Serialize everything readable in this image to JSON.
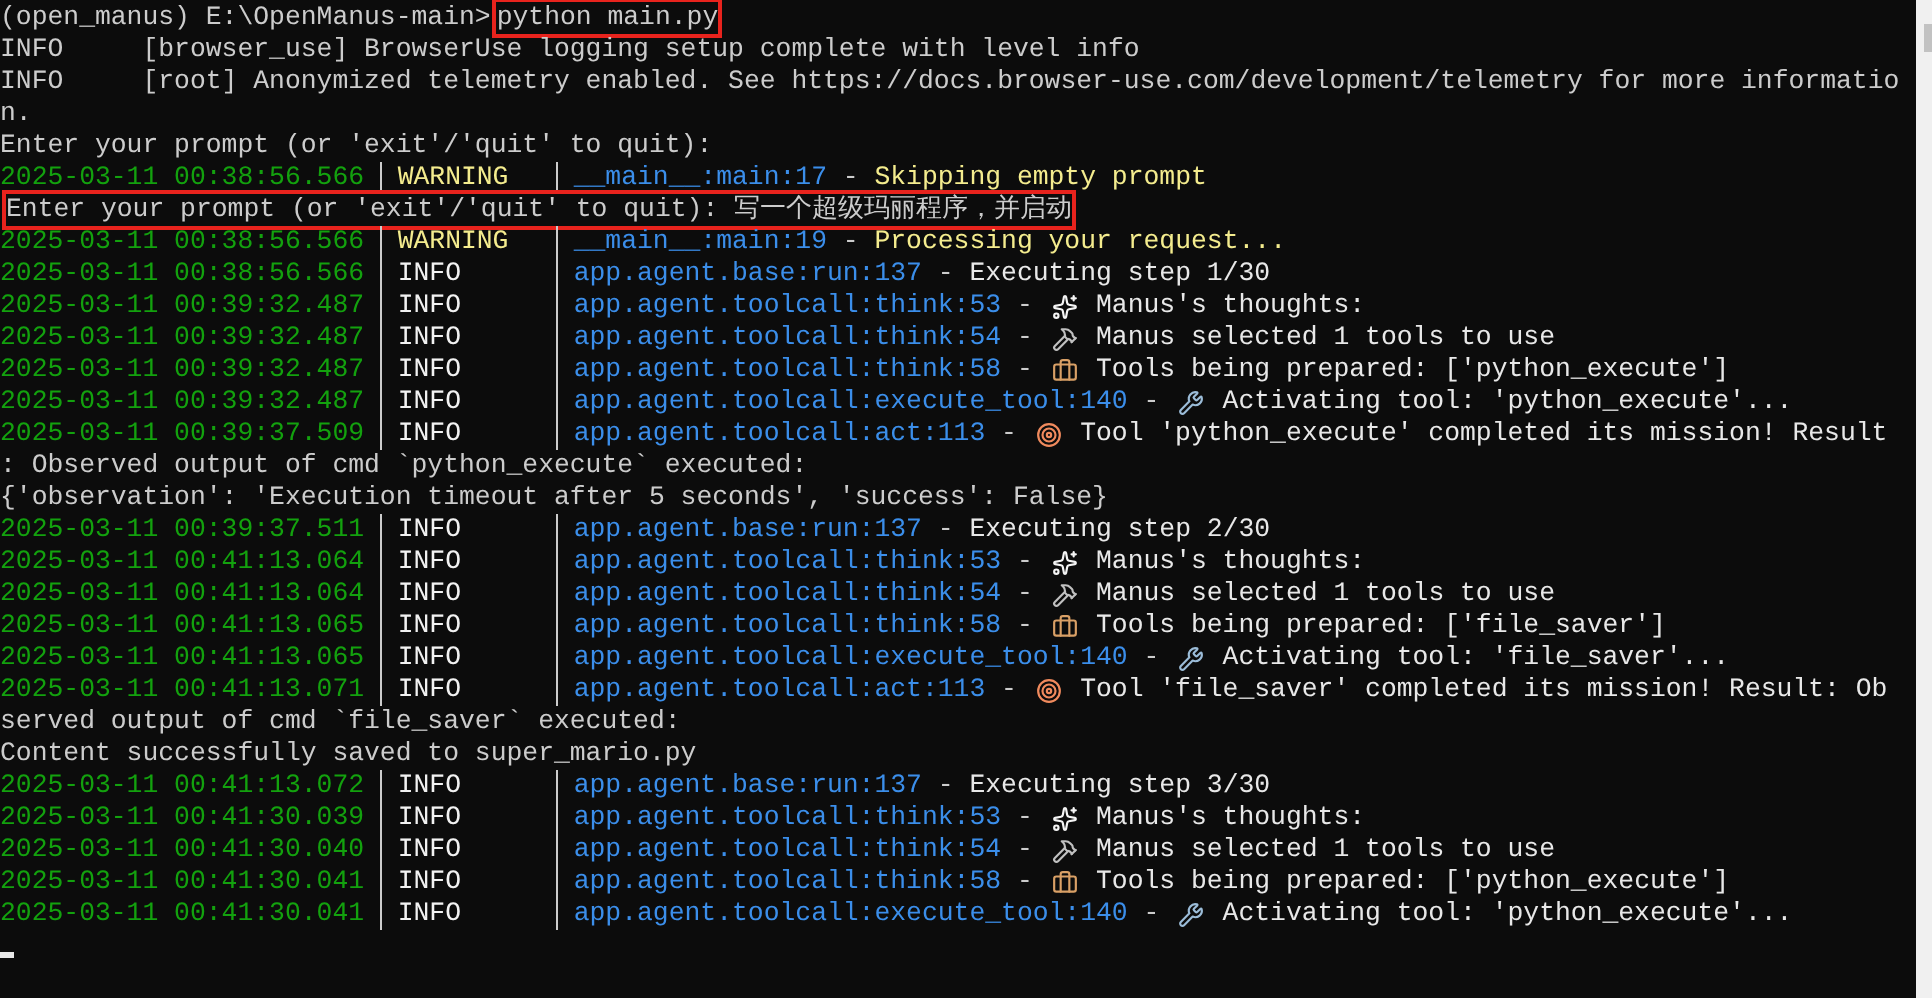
{
  "terminal": {
    "lines": [
      {
        "kind": "command",
        "prompt": "(open_manus) E:\\OpenManus-main>",
        "command": "python main.py",
        "highlighted": true
      },
      {
        "kind": "plain",
        "text": "INFO     [browser_use] BrowserUse logging setup complete with level info",
        "highlighted": false
      },
      {
        "kind": "plain",
        "text": "INFO     [root] Anonymized telemetry enabled. See https://docs.browser-use.com/development/telemetry for more informatio",
        "highlighted": false
      },
      {
        "kind": "plain",
        "text": "n.",
        "highlighted": false
      },
      {
        "kind": "plain",
        "text": "Enter your prompt (or 'exit'/'quit' to quit):",
        "highlighted": false
      },
      {
        "kind": "log",
        "time": "2025-03-11 00:38:56.566",
        "level": "WARNING",
        "module": "__main__:main:17",
        "sep": "-",
        "message": {
          "kind": "plain",
          "text": "Skipping empty prompt"
        }
      },
      {
        "kind": "plain",
        "text": "Enter your prompt (or 'exit'/'quit' to quit): 写一个超级玛丽程序，并启动",
        "highlighted": true
      },
      {
        "kind": "log",
        "time": "2025-03-11 00:38:56.566",
        "level": "WARNING",
        "module": "__main__:main:19",
        "sep": "-",
        "message": {
          "kind": "plain",
          "text": "Processing your request..."
        }
      },
      {
        "kind": "log",
        "time": "2025-03-11 00:38:56.566",
        "level": "INFO",
        "module": "app.agent.base:run:137",
        "sep": "-",
        "message": {
          "kind": "plain",
          "text": "Executing step 1/30"
        }
      },
      {
        "kind": "log",
        "time": "2025-03-11 00:39:32.487",
        "level": "INFO",
        "module": "app.agent.toolcall:think:53",
        "sep": "-",
        "message": {
          "kind": "thoughts",
          "text": "Manus's thoughts:"
        }
      },
      {
        "kind": "log",
        "time": "2025-03-11 00:39:32.487",
        "level": "INFO",
        "module": "app.agent.toolcall:think:54",
        "sep": "-",
        "message": {
          "kind": "selected",
          "text": "Manus selected 1 tools to use"
        }
      },
      {
        "kind": "log",
        "time": "2025-03-11 00:39:32.487",
        "level": "INFO",
        "module": "app.agent.toolcall:think:58",
        "sep": "-",
        "message": {
          "kind": "prepared",
          "text": "Tools being prepared: ['python_execute']"
        }
      },
      {
        "kind": "log",
        "time": "2025-03-11 00:39:32.487",
        "level": "INFO",
        "module": "app.agent.toolcall:execute_tool:140",
        "sep": "-",
        "message": {
          "kind": "activating",
          "text": "Activating tool: 'python_execute'..."
        }
      },
      {
        "kind": "log",
        "time": "2025-03-11 00:39:37.509",
        "level": "INFO",
        "module": "app.agent.toolcall:act:113",
        "sep": "-",
        "message": {
          "kind": "completed",
          "text": "Tool 'python_execute' completed its mission! Result"
        }
      },
      {
        "kind": "plain",
        "text": ": Observed output of cmd `python_execute` executed:",
        "highlighted": false
      },
      {
        "kind": "plain",
        "text": "{'observation': 'Execution timeout after 5 seconds', 'success': False}",
        "highlighted": false
      },
      {
        "kind": "log",
        "time": "2025-03-11 00:39:37.511",
        "level": "INFO",
        "module": "app.agent.base:run:137",
        "sep": "-",
        "message": {
          "kind": "plain",
          "text": "Executing step 2/30"
        }
      },
      {
        "kind": "log",
        "time": "2025-03-11 00:41:13.064",
        "level": "INFO",
        "module": "app.agent.toolcall:think:53",
        "sep": "-",
        "message": {
          "kind": "thoughts",
          "text": "Manus's thoughts:"
        }
      },
      {
        "kind": "log",
        "time": "2025-03-11 00:41:13.064",
        "level": "INFO",
        "module": "app.agent.toolcall:think:54",
        "sep": "-",
        "message": {
          "kind": "selected",
          "text": "Manus selected 1 tools to use"
        }
      },
      {
        "kind": "log",
        "time": "2025-03-11 00:41:13.065",
        "level": "INFO",
        "module": "app.agent.toolcall:think:58",
        "sep": "-",
        "message": {
          "kind": "prepared",
          "text": "Tools being prepared: ['file_saver']"
        }
      },
      {
        "kind": "log",
        "time": "2025-03-11 00:41:13.065",
        "level": "INFO",
        "module": "app.agent.toolcall:execute_tool:140",
        "sep": "-",
        "message": {
          "kind": "activating",
          "text": "Activating tool: 'file_saver'..."
        }
      },
      {
        "kind": "log",
        "time": "2025-03-11 00:41:13.071",
        "level": "INFO",
        "module": "app.agent.toolcall:act:113",
        "sep": "-",
        "message": {
          "kind": "completed",
          "text": "Tool 'file_saver' completed its mission! Result: Ob"
        }
      },
      {
        "kind": "plain",
        "text": "served output of cmd `file_saver` executed:",
        "highlighted": false
      },
      {
        "kind": "plain",
        "text": "Content successfully saved to super_mario.py",
        "highlighted": false
      },
      {
        "kind": "log",
        "time": "2025-03-11 00:41:13.072",
        "level": "INFO",
        "module": "app.agent.base:run:137",
        "sep": "-",
        "message": {
          "kind": "plain",
          "text": "Executing step 3/30"
        }
      },
      {
        "kind": "log",
        "time": "2025-03-11 00:41:30.039",
        "level": "INFO",
        "module": "app.agent.toolcall:think:53",
        "sep": "-",
        "message": {
          "kind": "thoughts",
          "text": "Manus's thoughts:"
        }
      },
      {
        "kind": "log",
        "time": "2025-03-11 00:41:30.040",
        "level": "INFO",
        "module": "app.agent.toolcall:think:54",
        "sep": "-",
        "message": {
          "kind": "selected",
          "text": "Manus selected 1 tools to use"
        }
      },
      {
        "kind": "log",
        "time": "2025-03-11 00:41:30.041",
        "level": "INFO",
        "module": "app.agent.toolcall:think:58",
        "sep": "-",
        "message": {
          "kind": "prepared",
          "text": "Tools being prepared: ['python_execute']"
        }
      },
      {
        "kind": "log",
        "time": "2025-03-11 00:41:30.041",
        "level": "INFO",
        "module": "app.agent.toolcall:execute_tool:140",
        "sep": "-",
        "message": {
          "kind": "activating",
          "text": "Activating tool: 'python_execute'..."
        }
      }
    ]
  }
}
